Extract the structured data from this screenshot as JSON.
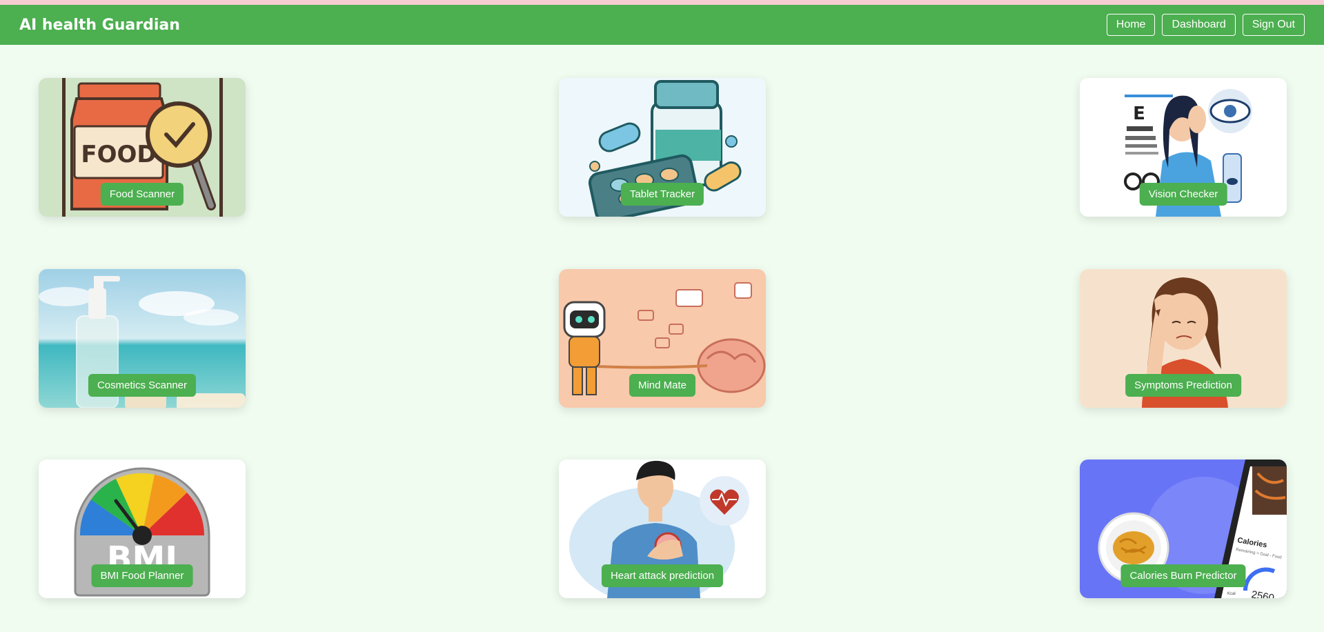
{
  "header": {
    "brand": "AI health Guardian",
    "nav": [
      "Home",
      "Dashboard",
      "Sign Out"
    ]
  },
  "theme": {
    "primary": "#4caf50",
    "background": "#f0fcf0",
    "strip": "#f5cdd3"
  },
  "cards": [
    {
      "label": "Food Scanner",
      "image": "food-scanner-illustration",
      "image_text": "FOOD"
    },
    {
      "label": "Tablet Tracker",
      "image": "pill-bottle-illustration"
    },
    {
      "label": "Vision Checker",
      "image": "eye-chart-illustration",
      "image_text": "E"
    },
    {
      "label": "Cosmetics Scanner",
      "image": "soap-bottle-beach-photo"
    },
    {
      "label": "Mind Mate",
      "image": "robot-pulling-brain-illustration"
    },
    {
      "label": "Symptoms Prediction",
      "image": "woman-headache-illustration"
    },
    {
      "label": "BMI Food Planner",
      "image": "bmi-gauge-illustration",
      "image_text": "BMI"
    },
    {
      "label": "Heart attack prediction",
      "image": "man-chest-pain-illustration"
    },
    {
      "label": "Calories Burn Predictor",
      "image": "calorie-app-illustration",
      "image_text": [
        "Calories",
        "Remaining = Goal - Food",
        "2560",
        "Kcal"
      ]
    }
  ]
}
